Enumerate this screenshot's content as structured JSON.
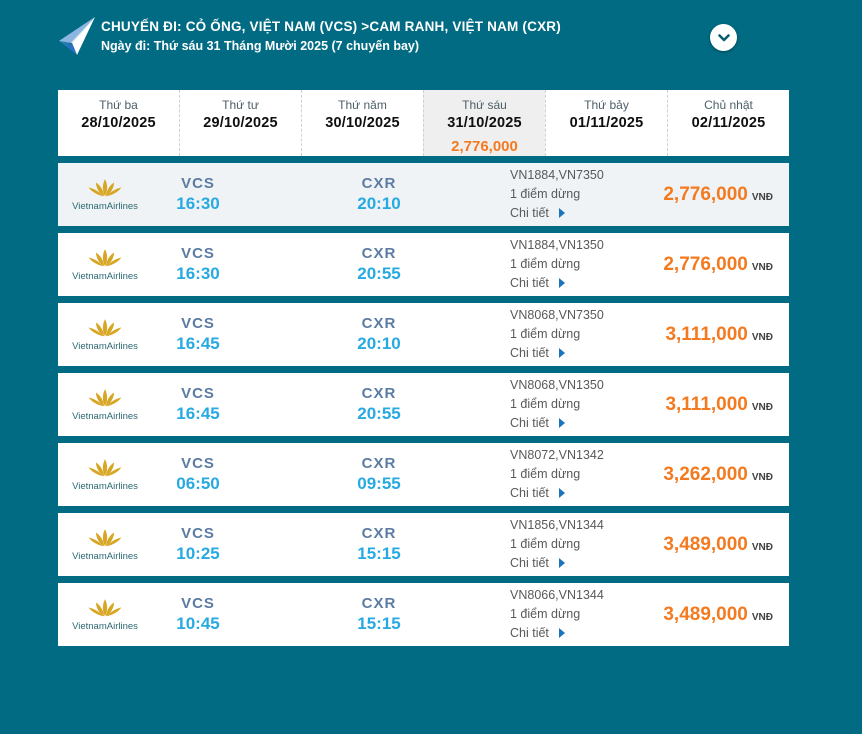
{
  "header": {
    "title": "CHUYẾN ĐI: CỎ ỐNG, VIỆT NAM (VCS) >CAM RANH, VIỆT NAM (CXR)",
    "subtitle": "Ngày đi: Thứ sáu 31 Tháng Mười 2025 (7 chuyến bay)",
    "icons": {
      "plane": "paper-plane-icon",
      "collapse": "chevron-down-icon"
    }
  },
  "date_tabs": [
    {
      "day": "Thứ ba",
      "date": "28/10/2025",
      "price": "",
      "selected": false
    },
    {
      "day": "Thứ tư",
      "date": "29/10/2025",
      "price": "",
      "selected": false
    },
    {
      "day": "Thứ năm",
      "date": "30/10/2025",
      "price": "",
      "selected": false
    },
    {
      "day": "Thứ sáu",
      "date": "31/10/2025",
      "price": "2,776,000",
      "selected": true
    },
    {
      "day": "Thứ bảy",
      "date": "01/11/2025",
      "price": "",
      "selected": false
    },
    {
      "day": "Chủ nhật",
      "date": "02/11/2025",
      "price": "",
      "selected": false
    }
  ],
  "flights": [
    {
      "airline": "VietnamAirlines",
      "dep_code": "VCS",
      "dep_time": "16:30",
      "arr_code": "CXR",
      "arr_time": "20:10",
      "flight_numbers": "VN1884,VN7350",
      "stops": "1 điểm dừng",
      "details_label": "Chi tiết",
      "price": "2,776,000",
      "currency": "VNĐ",
      "highlighted": true
    },
    {
      "airline": "VietnamAirlines",
      "dep_code": "VCS",
      "dep_time": "16:30",
      "arr_code": "CXR",
      "arr_time": "20:55",
      "flight_numbers": "VN1884,VN1350",
      "stops": "1 điểm dừng",
      "details_label": "Chi tiết",
      "price": "2,776,000",
      "currency": "VNĐ",
      "highlighted": false
    },
    {
      "airline": "VietnamAirlines",
      "dep_code": "VCS",
      "dep_time": "16:45",
      "arr_code": "CXR",
      "arr_time": "20:10",
      "flight_numbers": "VN8068,VN7350",
      "stops": "1 điểm dừng",
      "details_label": "Chi tiết",
      "price": "3,111,000",
      "currency": "VNĐ",
      "highlighted": false
    },
    {
      "airline": "VietnamAirlines",
      "dep_code": "VCS",
      "dep_time": "16:45",
      "arr_code": "CXR",
      "arr_time": "20:55",
      "flight_numbers": "VN8068,VN1350",
      "stops": "1 điểm dừng",
      "details_label": "Chi tiết",
      "price": "3,111,000",
      "currency": "VNĐ",
      "highlighted": false
    },
    {
      "airline": "VietnamAirlines",
      "dep_code": "VCS",
      "dep_time": "06:50",
      "arr_code": "CXR",
      "arr_time": "09:55",
      "flight_numbers": "VN8072,VN1342",
      "stops": "1 điểm dừng",
      "details_label": "Chi tiết",
      "price": "3,262,000",
      "currency": "VNĐ",
      "highlighted": false
    },
    {
      "airline": "VietnamAirlines",
      "dep_code": "VCS",
      "dep_time": "10:25",
      "arr_code": "CXR",
      "arr_time": "15:15",
      "flight_numbers": "VN1856,VN1344",
      "stops": "1 điểm dừng",
      "details_label": "Chi tiết",
      "price": "3,489,000",
      "currency": "VNĐ",
      "highlighted": false
    },
    {
      "airline": "VietnamAirlines",
      "dep_code": "VCS",
      "dep_time": "10:45",
      "arr_code": "CXR",
      "arr_time": "15:15",
      "flight_numbers": "VN8066,VN1344",
      "stops": "1 điểm dừng",
      "details_label": "Chi tiết",
      "price": "3,489,000",
      "currency": "VNĐ",
      "highlighted": false
    }
  ],
  "colors": {
    "background_teal": "#006b83",
    "price_orange": "#f47a20",
    "time_blue": "#27a9e1",
    "code_blue": "#5c7ca3",
    "selected_tab_bg": "#efefef",
    "highlight_row_bg": "#eff3f5",
    "detail_arrow_blue": "#1b75bc",
    "lotus_gold": "#d8a625"
  }
}
